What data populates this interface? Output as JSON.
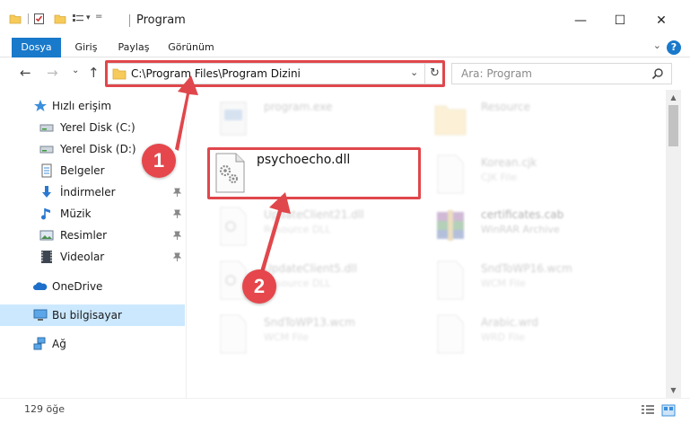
{
  "window": {
    "title": "Program",
    "minimize_glyph": "—",
    "maximize_glyph": "☐",
    "close_glyph": "✕"
  },
  "ribbon": {
    "tabs": [
      {
        "label": "Dosya"
      },
      {
        "label": "Giriş"
      },
      {
        "label": "Paylaş"
      },
      {
        "label": "Görünüm"
      }
    ],
    "help_glyph": "?",
    "collapse_glyph": "⌄"
  },
  "nav": {
    "back_glyph": "←",
    "forward_glyph": "→",
    "recent_glyph": "⌄",
    "up_glyph": "↑",
    "address": "C:\\Program Files\\Program Dizini",
    "address_dropdown_glyph": "⌄",
    "refresh_glyph": "↻",
    "search_placeholder": "Ara: Program"
  },
  "sidebar": {
    "items": [
      {
        "label": "Hızlı erişim",
        "icon": "star-icon"
      },
      {
        "label": "Yerel Disk (C:)",
        "icon": "drive-icon"
      },
      {
        "label": "Yerel Disk (D:)",
        "icon": "drive-icon"
      },
      {
        "label": "Belgeler",
        "icon": "documents-icon"
      },
      {
        "label": "İndirmeler",
        "icon": "download-icon"
      },
      {
        "label": "Müzik",
        "icon": "music-icon"
      },
      {
        "label": "Resimler",
        "icon": "pictures-icon"
      },
      {
        "label": "Videolar",
        "icon": "video-icon"
      },
      {
        "label": "OneDrive",
        "icon": "cloud-icon"
      },
      {
        "label": "Bu bilgisayar",
        "icon": "computer-icon"
      },
      {
        "label": "Ağ",
        "icon": "network-icon"
      }
    ]
  },
  "files": [
    {
      "name": "program.exe",
      "type": ""
    },
    {
      "name": "Resource",
      "type": ""
    },
    {
      "name": "psychoecho.dll",
      "type": ""
    },
    {
      "name": "Korean.cjk",
      "type": "CJK File"
    },
    {
      "name": "UpdateClient21.dll",
      "type": "Resource DLL"
    },
    {
      "name": "certificates.cab",
      "type": "WinRAR Archive"
    },
    {
      "name": "UpdateClient5.dll",
      "type": "Resource DLL"
    },
    {
      "name": "SndToWP16.wcm",
      "type": "WCM File"
    },
    {
      "name": "SndToWP13.wcm",
      "type": "WCM File"
    },
    {
      "name": "Arabic.wrd",
      "type": "WRD File"
    }
  ],
  "status": {
    "count": "129 öğe"
  },
  "annotations": {
    "step1": "1",
    "step2": "2",
    "color": "#e0474c"
  },
  "colors": {
    "accent": "#1979ca",
    "selection": "#cce8ff"
  }
}
